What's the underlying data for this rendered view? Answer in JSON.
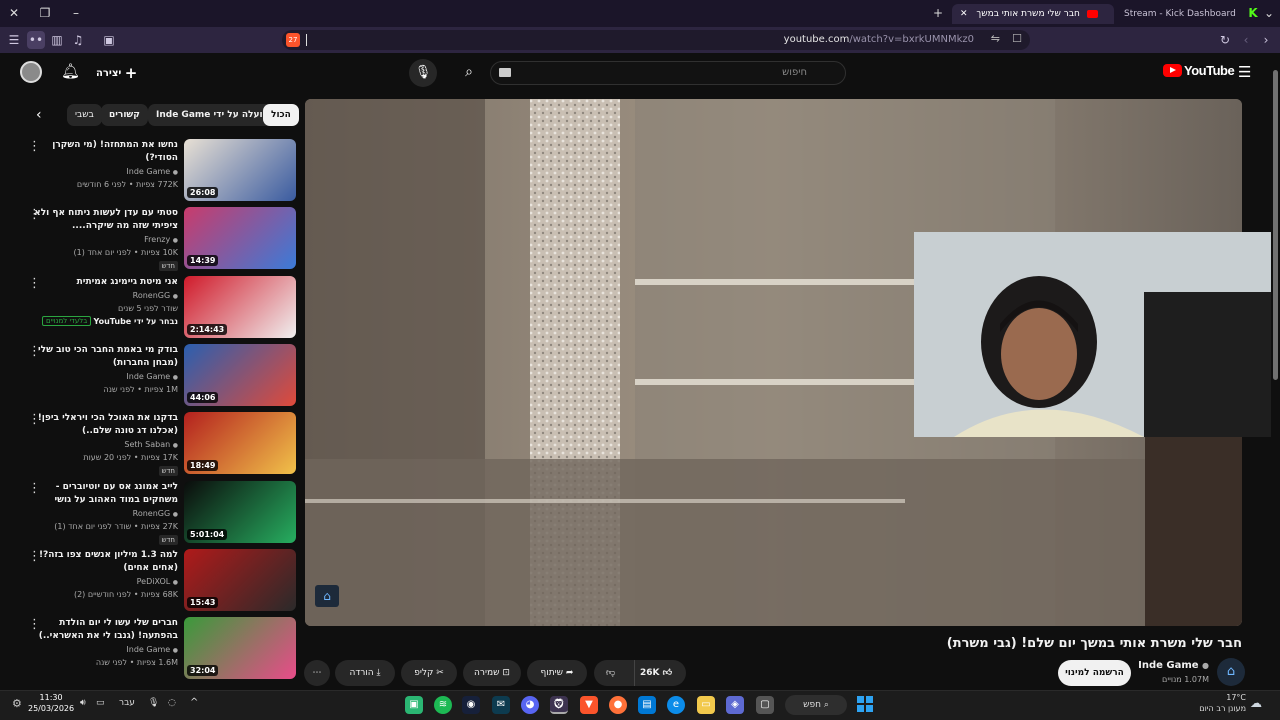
{
  "browser": {
    "tabs": [
      {
        "label": "Stream - Kick Dashboard"
      },
      {
        "label": "חבר שלי משרת אותי במשך"
      }
    ],
    "url_host": "youtube.com",
    "url_path": "/watch?v=bxrkUMNMkz0",
    "shield_badge": "27"
  },
  "youtube": {
    "logo": "YouTube",
    "search_placeholder": "חיפוש",
    "create_label": "יצירה",
    "chips": [
      "הכול",
      "הועלה על ידי Inde Game",
      "קשורים",
      "בשבי"
    ],
    "video_title": "חבר שלי משרת אותי במשך יום שלם! (גבי משרת)",
    "channel_name": "Inde Game",
    "subscribers": "1.07M מנויים",
    "subscribe_label": "הרשמה למינוי",
    "likes": "26K",
    "share_label": "שיתוף",
    "save_label": "שמירה",
    "clip_label": "קליפ",
    "download_label": "הורדה"
  },
  "sidebar": [
    {
      "title": "נחשו את המתחזה! (מי השקרן הסודי?)",
      "channel": "Inde Game",
      "meta": "772K צפיות • לפני 6 חודשים",
      "duration": "26:08",
      "badge": ""
    },
    {
      "title": "סטתי עם עדן לעשות ניתוח אף ולא ציפיתי שזה מה שיקרה....",
      "channel": "Frenzy",
      "meta": "10K צפיות • לפני יום אחד (1)",
      "duration": "14:39",
      "badge": "חדש"
    },
    {
      "title": "אני מיטת גיימינג אמיתית",
      "channel": "RonenGG",
      "meta": "שודר לפני 5 שנים",
      "duration": "2:14:43",
      "badge": "",
      "extra": "נבחר על ידי YouTube",
      "extra2": "בלעדי למנויים"
    },
    {
      "title": "בודק מי באמת החבר הכי טוב שלי (מבחן החברות)",
      "channel": "Inde Game",
      "meta": "1M צפיות • לפני שנה",
      "duration": "44:06",
      "badge": ""
    },
    {
      "title": "בדקנו את האוכל הכי ויראלי ביפן! (אכלנו דג טונה שלם..)",
      "channel": "Seth Saban",
      "meta": "17K צפיות • לפני 20 שעות",
      "duration": "18:49",
      "badge": "חדש"
    },
    {
      "title": "לייב אמונג אס עם יוטיוברים - משחקים במוד האהוב על גושי",
      "channel": "RonenGG",
      "meta": "27K צפיות • שודר לפני יום אחד (1)",
      "duration": "5:01:04",
      "badge": "חדש"
    },
    {
      "title": "למה 1.3 מיליון אנשים צפו בזה?! (אחים אחים)",
      "channel": "PeDiXOL",
      "meta": "68K צפיות • לפני חודשיים (2)",
      "duration": "15:43",
      "badge": ""
    },
    {
      "title": "חברים שלי עשו לי יום הולדת בהפתעה! (גנבו לי את האשראי..)",
      "channel": "Inde Game",
      "meta": "1.6M צפיות • לפני שנה",
      "duration": "32:04",
      "badge": ""
    }
  ],
  "taskbar": {
    "search_label": "חפש",
    "time": "11:30",
    "date": "25/03/2026",
    "lang": "עבר",
    "weather_temp": "17°C",
    "weather_desc": "מעונן רב היום"
  },
  "colors": {
    "youtube_red": "#ff0000",
    "browser_bg": "#2d2540",
    "page_bg": "#0f0f0f"
  }
}
